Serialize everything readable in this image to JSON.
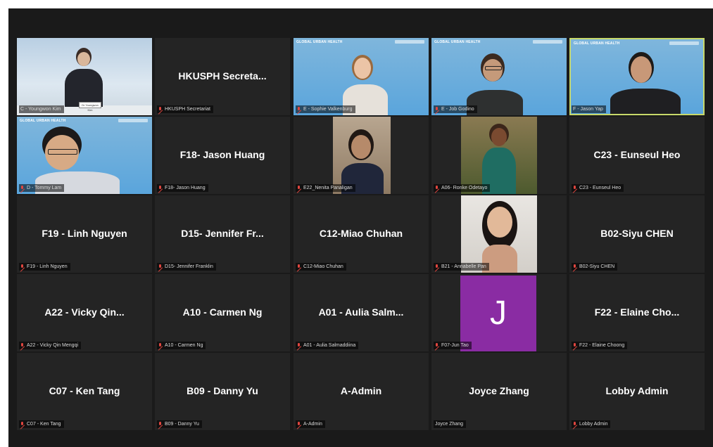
{
  "grid": {
    "tiles": [
      {
        "big_name": "",
        "tag": "C - Youngwon Kim",
        "muted": false,
        "video": "speaker-desk"
      },
      {
        "big_name": "HKUSPH Secreta...",
        "tag": "HKUSPH Secretariat",
        "muted": true,
        "video": ""
      },
      {
        "big_name": "",
        "tag": "E - Sophie Valkenburg",
        "muted": true,
        "video": "blue-woman"
      },
      {
        "big_name": "",
        "tag": "E - Job Godino",
        "muted": true,
        "video": "blue-man-glasses"
      },
      {
        "big_name": "",
        "tag": "F - Jason Yap",
        "muted": false,
        "video": "blue-man",
        "speaking": true
      },
      {
        "big_name": "",
        "tag": "D - Tommy Lam",
        "muted": true,
        "video": "blue-man-glasses-2"
      },
      {
        "big_name": "F18- Jason Huang",
        "tag": "F18- Jason Huang",
        "muted": true,
        "video": ""
      },
      {
        "big_name": "",
        "tag": "E22_Nenita Panaligan",
        "muted": true,
        "video": "portrait-woman"
      },
      {
        "big_name": "",
        "tag": "A06- Ronke Odetayo",
        "muted": true,
        "video": "portrait-outdoor"
      },
      {
        "big_name": "C23 - Eunseul Heo",
        "tag": "C23 - Eunseul Heo",
        "muted": true,
        "video": ""
      },
      {
        "big_name": "F19 - Linh Nguyen",
        "tag": "F19 - Linh Nguyen",
        "muted": true,
        "video": ""
      },
      {
        "big_name": "D15- Jennifer Fr...",
        "tag": "D15- Jennifer Franklin",
        "muted": true,
        "video": ""
      },
      {
        "big_name": "C12-Miao Chuhan",
        "tag": "C12-Miao Chuhan",
        "muted": true,
        "video": ""
      },
      {
        "big_name": "",
        "tag": "B21 - Annabelle Pan",
        "muted": true,
        "video": "portrait-smile"
      },
      {
        "big_name": "B02-Siyu CHEN",
        "tag": "B02-Siyu CHEN",
        "muted": true,
        "video": ""
      },
      {
        "big_name": "A22 - Vicky Qin...",
        "tag": "A22 - Vicky Qin Mengqi",
        "muted": true,
        "video": ""
      },
      {
        "big_name": "A10 - Carmen Ng",
        "tag": "A10 - Carmen Ng",
        "muted": true,
        "video": ""
      },
      {
        "big_name": "A01 - Aulia Salm...",
        "tag": "A01 - Aulia Salmaddiina",
        "muted": true,
        "video": ""
      },
      {
        "big_name": "",
        "tag": "F07-Jun Tao",
        "muted": false,
        "video": "avatar",
        "avatar_letter": "J"
      },
      {
        "big_name": "F22 - Elaine Cho...",
        "tag": "F22 - Elaine Choong",
        "muted": true,
        "video": ""
      },
      {
        "big_name": "C07 - Ken Tang",
        "tag": "C07 - Ken Tang",
        "muted": true,
        "video": ""
      },
      {
        "big_name": "B09 - Danny Yu",
        "tag": "B09 - Danny Yu",
        "muted": true,
        "video": ""
      },
      {
        "big_name": "A-Admin",
        "tag": "A-Admin",
        "muted": true,
        "video": ""
      },
      {
        "big_name": "Joyce Zhang",
        "tag": "Joyce Zhang",
        "muted": false,
        "video": ""
      },
      {
        "big_name": "Lobby Admin",
        "tag": "Lobby Admin",
        "muted": true,
        "video": ""
      }
    ],
    "banner_text": "GLOBAL URBAN HEALTH",
    "desk_sign": "Dr Youngwon Kim"
  },
  "colors": {
    "window_bg": "#1a1a1a",
    "tile_bg": "#242424",
    "active_speaker_border": "#c7d86a",
    "muted_icon": "#e2463f",
    "avatar_bg": "#8a2ca3"
  }
}
